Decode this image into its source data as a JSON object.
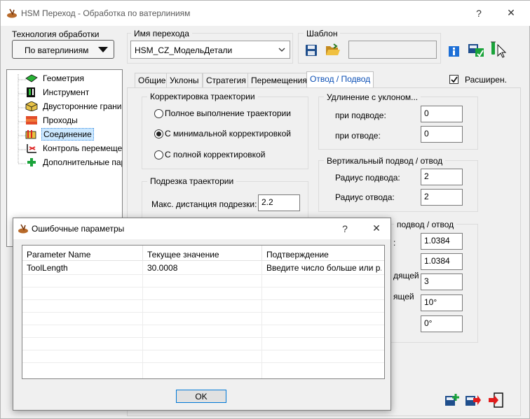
{
  "window": {
    "title": "HSM Переход - Обработка по ватерлиниям",
    "help_glyph": "?",
    "close_glyph": "✕"
  },
  "top": {
    "tech_label": "Технология обработки",
    "tech_value": "По ватерлиниям",
    "name_label": "Имя перехода",
    "name_value": "HSM_CZ_МодельДетали",
    "template_label": "Шаблон",
    "template_value": ""
  },
  "tree": {
    "items": [
      {
        "label": "Геометрия",
        "icon": "geometry-icon"
      },
      {
        "label": "Инструмент",
        "icon": "tool-icon"
      },
      {
        "label": "Двусторонние границы",
        "icon": "bounds-icon"
      },
      {
        "label": "Проходы",
        "icon": "passes-icon"
      },
      {
        "label": "Соединение",
        "icon": "link-icon",
        "selected": true
      },
      {
        "label": "Контроль перемещений",
        "icon": "motion-control-icon"
      },
      {
        "label": "Дополнительные параметры",
        "icon": "plus-icon"
      }
    ]
  },
  "tabs": [
    "Общие",
    "Уклоны",
    "Стратегия",
    "Перемещения",
    "Отвод / Подвод"
  ],
  "active_tab": "Отвод / Подвод",
  "extended": {
    "label": "Расширен.",
    "checked": true
  },
  "traj_correction": {
    "title": "Корректировка траектории",
    "options": [
      "Полное выполнение траектории",
      "С минимальной корректировкой",
      "С полной корректировкой"
    ],
    "selected_index": 1
  },
  "traj_trim": {
    "title": "Подрезка траектории",
    "max_label": "Макс. дистанция подрезки:",
    "max_value": "2.2"
  },
  "slope_ext": {
    "title": "Удлинение с уклоном...",
    "approach_label": "при подводе:",
    "approach_value": "0",
    "retract_label": "при отводе:",
    "retract_value": "0"
  },
  "vertical": {
    "title": "Вертикальный подвод / отвод",
    "approach_label": "Радиус подвода:",
    "approach_value": "2",
    "retract_label": "Радиус отвода:",
    "retract_value": "2"
  },
  "horizontal": {
    "title_fragment": "подвод / отвод",
    "row1_fragment": ":",
    "row1_value": "1.0384",
    "row2_value": "1.0384",
    "row3_fragment": "дящей",
    "row3_value": "3",
    "row4_fragment": "ящей",
    "row4_value": "10°",
    "row5_value": "0°"
  },
  "dialog": {
    "title": "Ошибочные параметры",
    "help_glyph": "?",
    "close_glyph": "✕",
    "columns": [
      "Parameter Name",
      "Текущее значение",
      "Подтверждение"
    ],
    "rows": [
      [
        "ToolLength",
        "30.0008",
        "Введите число больше или р..."
      ]
    ],
    "ok_label": "OK"
  },
  "colors": {
    "accent": "#0078d7",
    "active_tab_text": "#0b4fb5",
    "selection": "#cce8ff"
  }
}
